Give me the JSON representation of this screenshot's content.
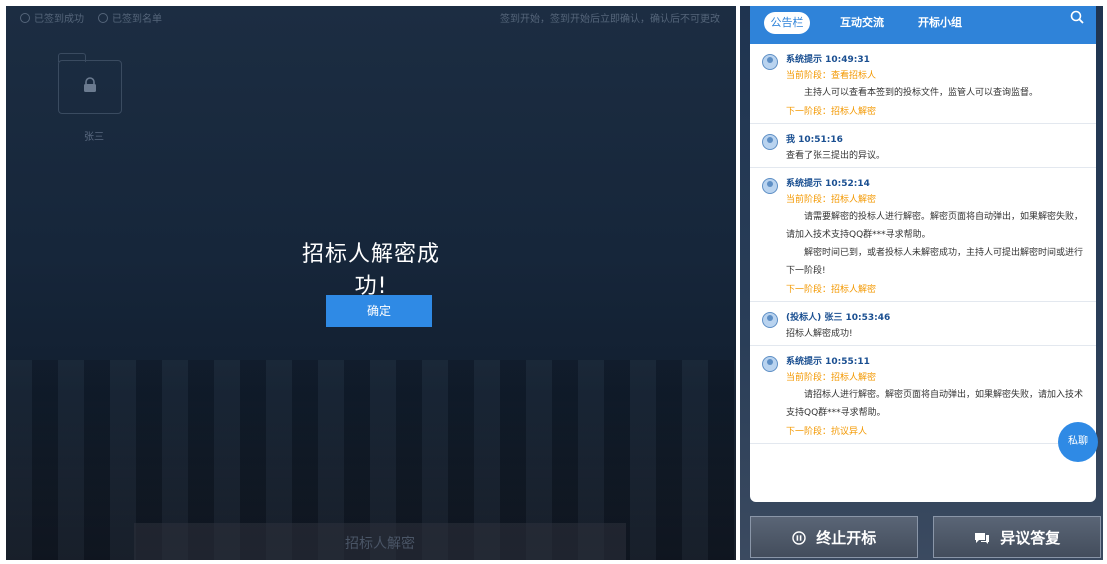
{
  "stage": {
    "top_left_items": [
      "已签到成功",
      "已签到名单"
    ],
    "top_right_text": "签到开始，签到开始后立即确认，确认后不可更改",
    "folder_label": "张三",
    "dialog_title": "招标人解密成功!",
    "confirm_label": "确定",
    "bottom_bar_label": "招标人解密"
  },
  "panel": {
    "tabs": [
      "公告栏",
      "互动交流",
      "开标小组"
    ],
    "active_tab": "公告栏",
    "float_button_label": "私聊",
    "messages": [
      {
        "head": "系统提示 10:49:31",
        "current_stage": "当前阶段：查看招标人",
        "body": [
          "  主持人可以查看本签到的投标文件，监管人可以查询监督。"
        ],
        "next": "下一阶段：招标人解密"
      },
      {
        "head": "我 10:51:16",
        "plain": "查看了张三提出的异议。"
      },
      {
        "head": "系统提示 10:52:14",
        "current_stage": "当前阶段：招标人解密",
        "body": [
          "  请需要解密的投标人进行解密。解密页面将自动弹出，如果解密失败，请加入技术支持QQ群***寻求帮助。",
          "  解密时间已到，或者投标人未解密成功，主持人可提出解密时间或进行下一阶段!"
        ],
        "next": "下一阶段：招标人解密"
      },
      {
        "head": "(投标人) 张三 10:53:46",
        "plain": "招标人解密成功!"
      },
      {
        "head": "系统提示 10:55:11",
        "current_stage": "当前阶段：招标人解密",
        "body": [
          "  请招标人进行解密。解密页面将自动弹出，如果解密失败，请加入技术支持QQ群***寻求帮助。"
        ],
        "next": "下一阶段：抗议异人"
      }
    ]
  },
  "actions": {
    "stop_label": "终止开标",
    "objection_label": "异议答复"
  }
}
